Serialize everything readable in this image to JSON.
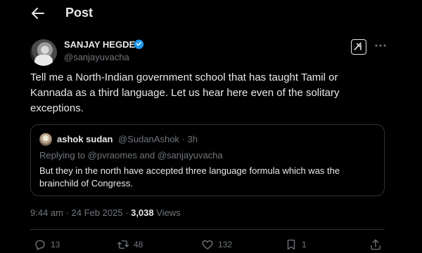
{
  "header": {
    "title": "Post"
  },
  "author": {
    "display_name": "SANJAY HEGDE",
    "handle": "@sanjayuvacha",
    "verified": true,
    "verified_color": "#1d9bf0"
  },
  "tweet": {
    "text": "Tell me a North-Indian government school that has taught Tamil or Kannada as a third language. Let us hear here even of the solitary exceptions."
  },
  "quote": {
    "name": "ashok sudan",
    "meta": "@SudanAshok · 3h",
    "replying_prefix": "Replying to ",
    "replying_to_1": "@pvraomes",
    "replying_and": " and ",
    "replying_to_2": "@sanjayuvacha",
    "text": "But they in the north have accepted three language formula which was the brainchild of Congress."
  },
  "meta": {
    "time": "9:44 am · 24 Feb 2025 · ",
    "views_count": "3,038",
    "views_label": " Views"
  },
  "actions": {
    "replies": "13",
    "reposts": "48",
    "likes": "132",
    "bookmarks": "1"
  },
  "icons": {
    "back": "arrow-left-icon",
    "verified": "verified-badge-icon",
    "grok": "grok-icon",
    "more": "more-dots-icon",
    "reply": "reply-icon",
    "repost": "repost-icon",
    "like": "heart-icon",
    "bookmark": "bookmark-icon",
    "share": "share-icon"
  },
  "colors": {
    "background": "#000000",
    "text": "#e7e9ea",
    "muted": "#71767b",
    "border": "#2f3336"
  }
}
